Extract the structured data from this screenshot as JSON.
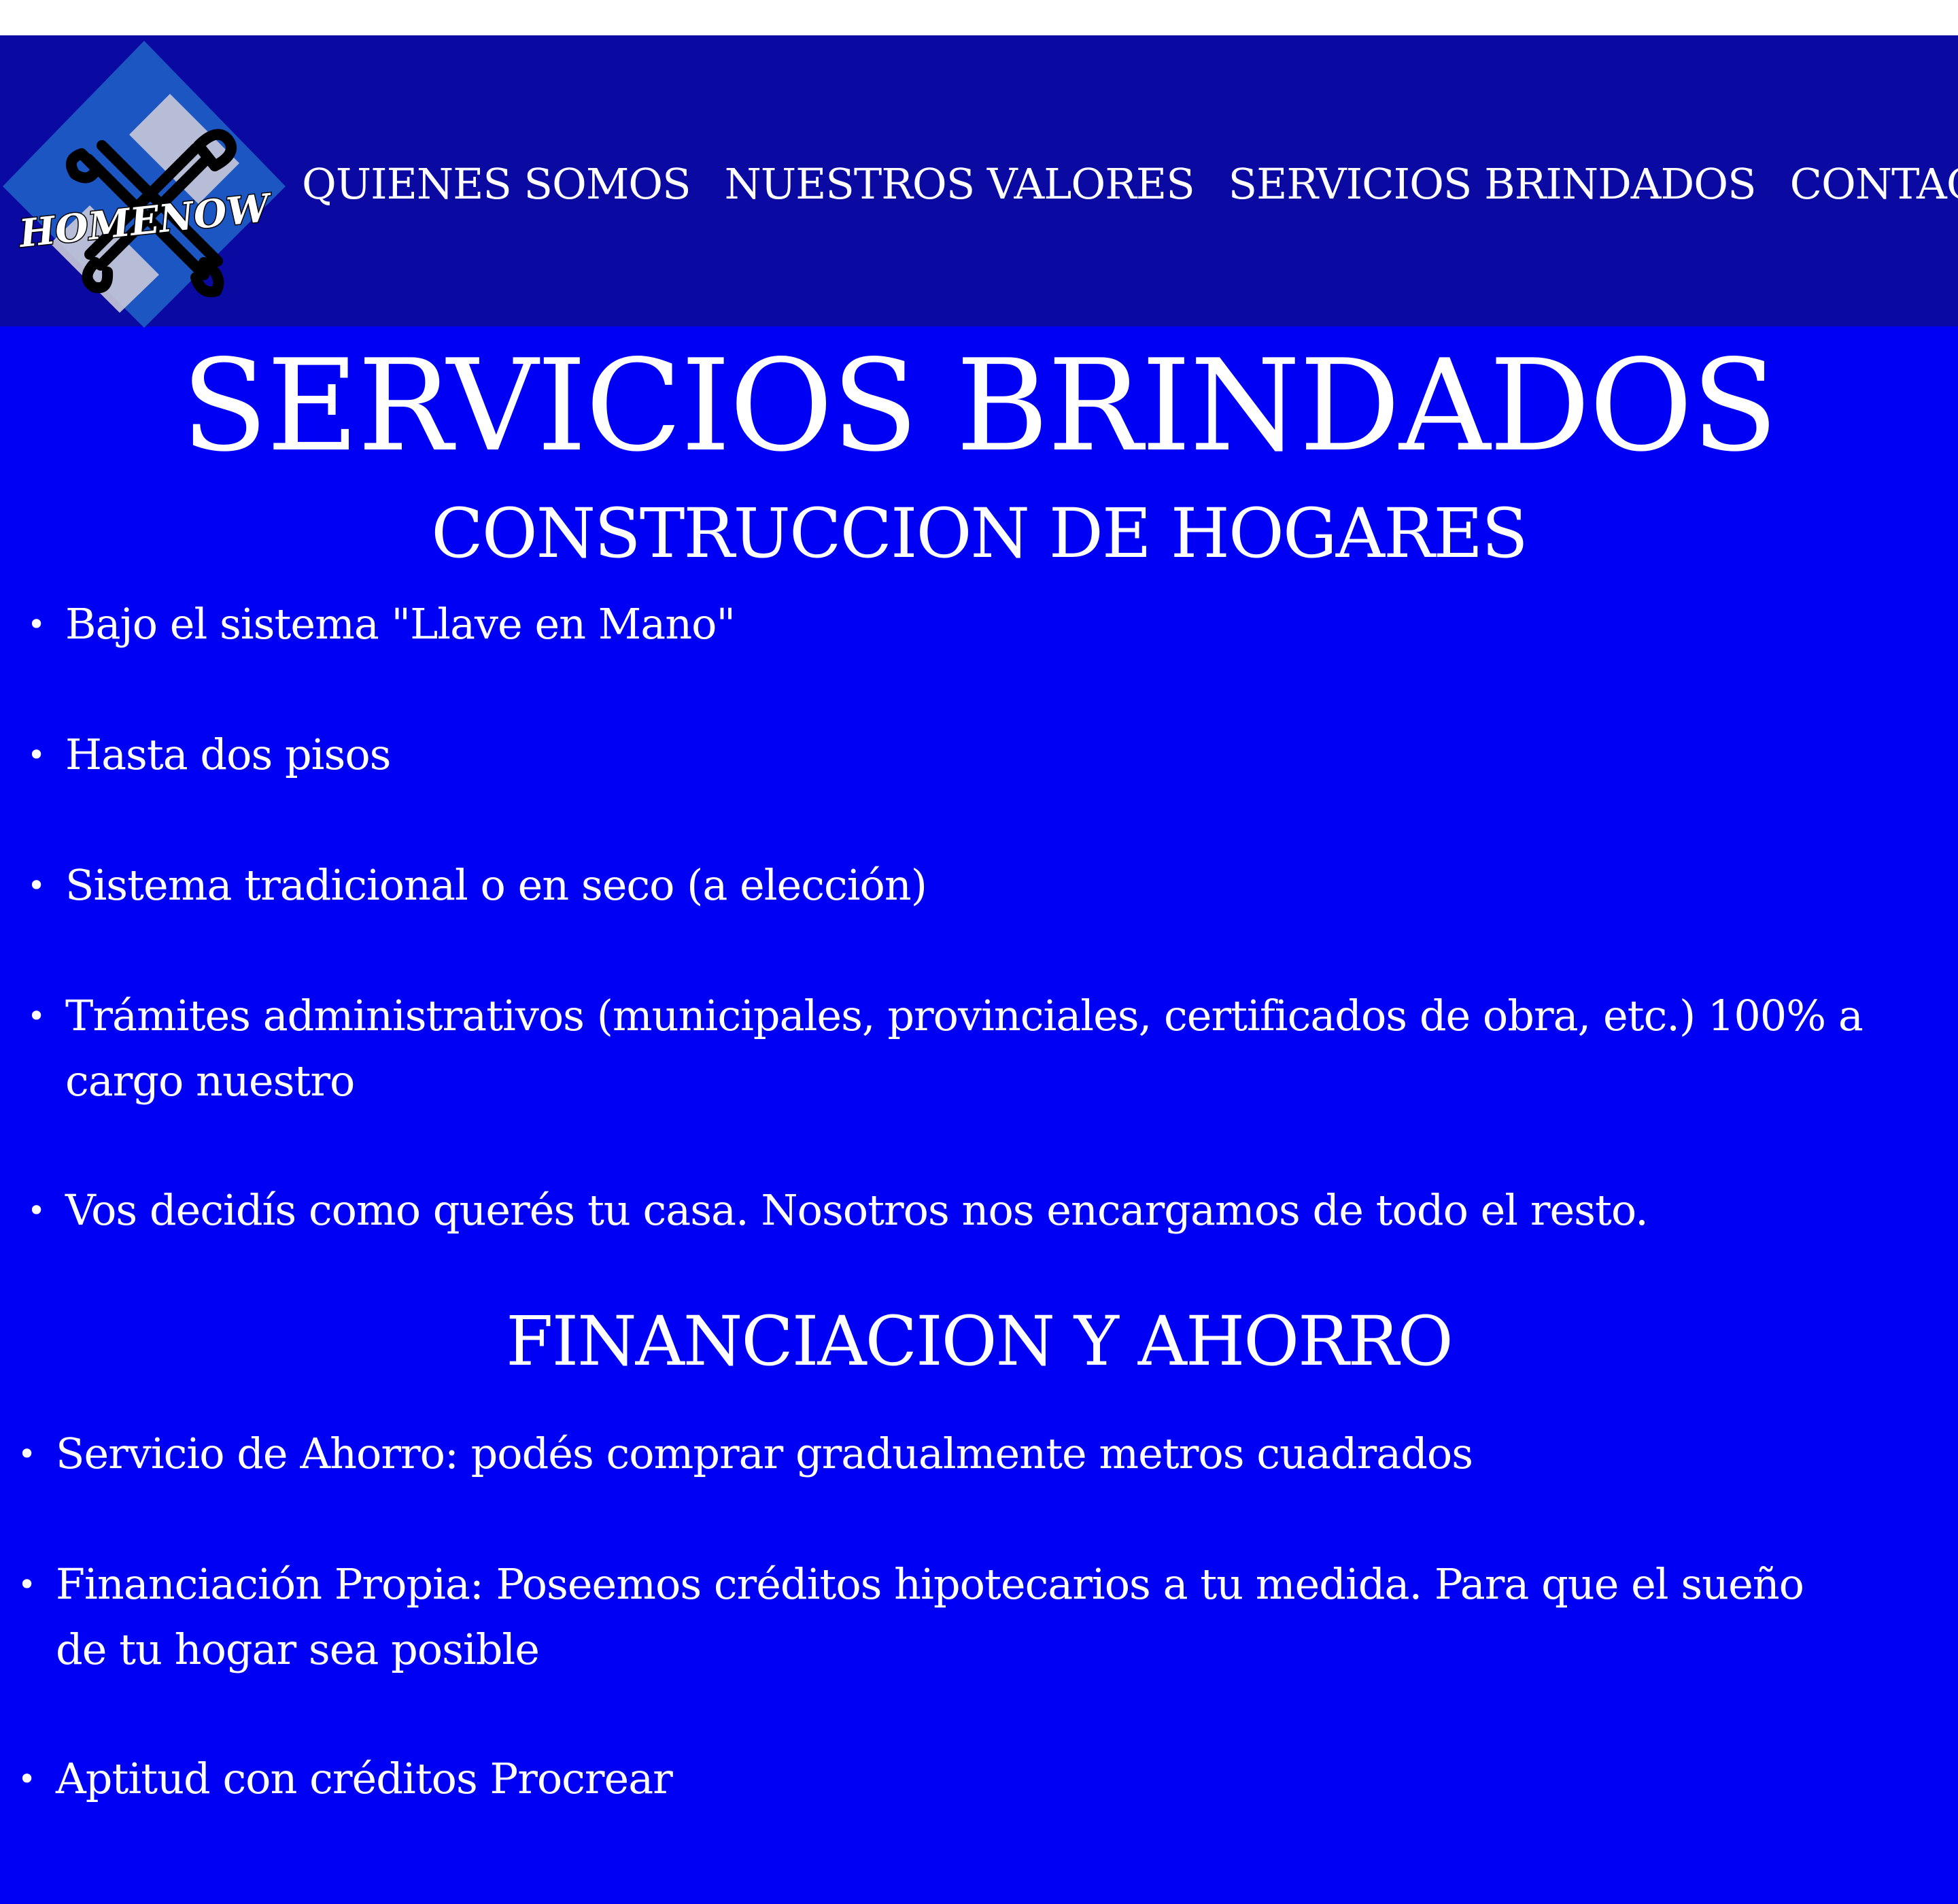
{
  "logo": {
    "text": "HOMENOW",
    "icon": "wrench-screwdriver-icon"
  },
  "nav": {
    "items": [
      "QUIENES SOMOS",
      "NUESTROS VALORES",
      "SERVICIOS BRINDADOS",
      "CONTACTO"
    ]
  },
  "page_title": "SERVICIOS BRINDADOS",
  "sections": [
    {
      "title": "CONSTRUCCION DE HOGARES",
      "items": [
        "Bajo el sistema \"Llave en Mano\"",
        "Hasta dos pisos",
        "Sistema tradicional o en seco (a elección)",
        "Trámites administrativos (municipales, provinciales, certificados de obra, etc.) 100% a cargo nuestro",
        "Vos decidís como querés tu casa. Nosotros nos encargamos de todo el resto."
      ]
    },
    {
      "title": "FINANCIACION Y AHORRO",
      "items": [
        "Servicio de Ahorro: podés comprar gradualmente metros cuadrados",
        "Financiación Propia: Poseemos créditos hipotecarios a tu medida. Para que el sueño de tu hogar sea posible",
        "Aptitud con créditos Procrear"
      ]
    }
  ],
  "bullet": "•",
  "colors": {
    "page_background": "#0000f5",
    "navbar_background": "#0a0aa3",
    "logo_diamond": "#1b56c2",
    "text": "#ffffff"
  }
}
